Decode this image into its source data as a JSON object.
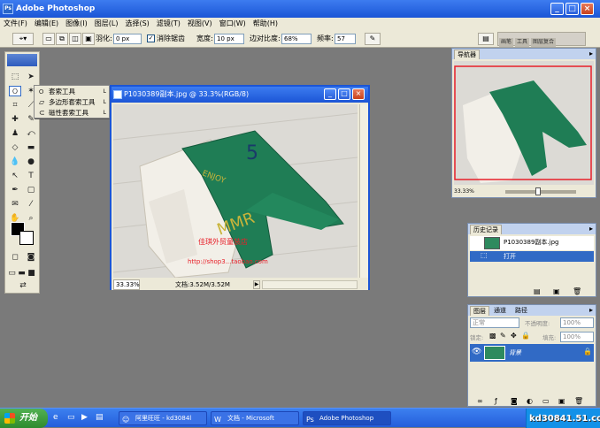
{
  "titlebar": {
    "title": "Adobe Photoshop"
  },
  "menu": [
    "文件(F)",
    "编辑(E)",
    "图像(I)",
    "图层(L)",
    "选择(S)",
    "滤镜(T)",
    "视图(V)",
    "窗口(W)",
    "帮助(H)"
  ],
  "options": {
    "feather_label": "羽化:",
    "feather_value": "0 px",
    "antialias_label": "消除锯齿",
    "width_label": "宽度:",
    "width_value": "10 px",
    "contrast_label": "边对比度:",
    "contrast_value": "68%",
    "frequency_label": "频率:",
    "frequency_value": "57",
    "well_tabs": [
      "画笔",
      "工具",
      "图层复合"
    ]
  },
  "flyout": {
    "items": [
      {
        "label": "套索工具",
        "key": "L"
      },
      {
        "label": "多边形套索工具",
        "key": "L"
      },
      {
        "label": "磁性套索工具",
        "key": "L"
      }
    ]
  },
  "document": {
    "title": "P1030389副本.jpg @ 33.3%(RGB/8)",
    "zoom": "33.33%",
    "docsize": "文档:3.52M/3.52M",
    "watermark_line1": "佳琪外贸童装店",
    "watermark_line2": "http://shop3...taobao.com"
  },
  "navigator": {
    "title": "导航器",
    "zoom": "33.33%"
  },
  "history": {
    "title": "历史记录",
    "snapshot": "P1030389副本.jpg",
    "step": "打开"
  },
  "layers": {
    "tabs": [
      "图层",
      "通道",
      "路径"
    ],
    "blend_mode": "正常",
    "opacity_label": "不透明度:",
    "opacity_value": "100%",
    "lock_label": "锁定:",
    "fill_label": "填充:",
    "fill_value": "100%",
    "layer_name": "背景"
  },
  "taskbar": {
    "start": "开始",
    "tasks": [
      "阿里旺旺 - kd3084l",
      "文档 - Microsoft",
      "Adobe Photoshop"
    ],
    "watermark": "kd30841.51.com"
  }
}
